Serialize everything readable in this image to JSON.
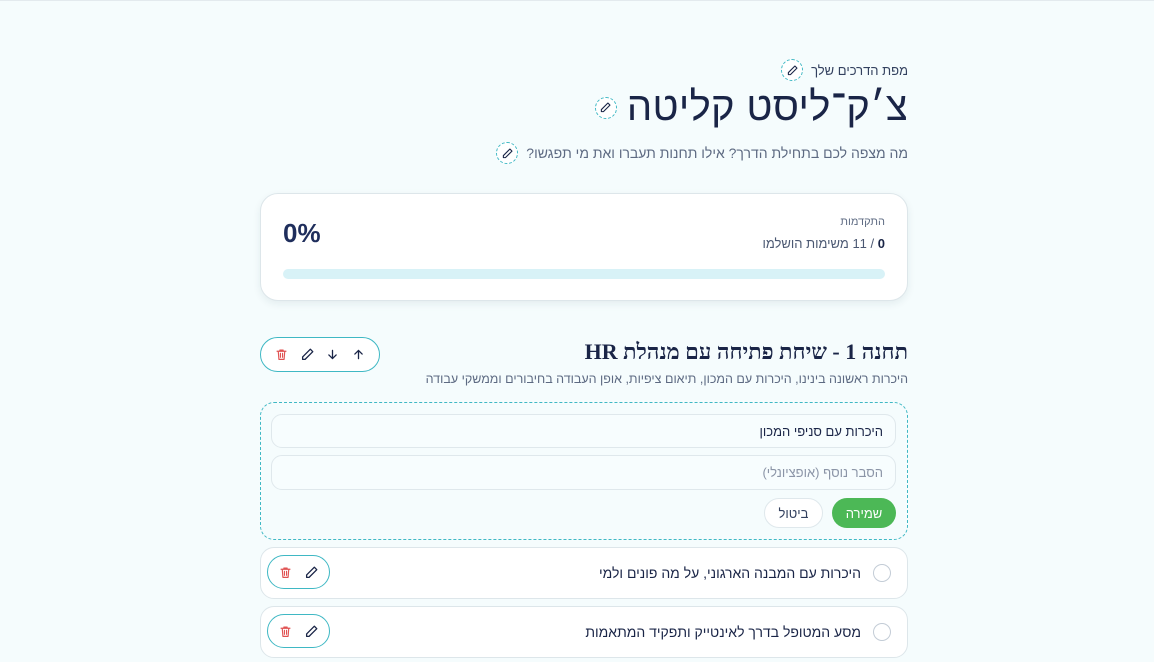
{
  "header": {
    "eyebrow": "מפת הדרכים שלך",
    "title": "צ׳ק־ליסט קליטה",
    "subtitle": "מה מצפה לכם בתחילת הדרך? אילו תחנות תעברו ואת מי תפגשו?"
  },
  "progress": {
    "label": "התקדמות",
    "completed": "0",
    "total_text": "/ 11 משימות הושלמו",
    "percent_text": "0%",
    "fraction": 0
  },
  "station": {
    "title": "תחנה 1 - שיחת פתיחה עם מנהלת HR",
    "description": "היכרות ראשונה בינינו, היכרות עם המכון, תיאום ציפיות, אופן העבודה בחיבורים וממשקי עבודה"
  },
  "edit_form": {
    "title_value": "היכרות עם סניפי המכון",
    "description_placeholder": "הסבר נוסף (אופציונלי)",
    "save_label": "שמירה",
    "cancel_label": "ביטול"
  },
  "tasks": [
    {
      "text": "היכרות עם המבנה הארגוני, על מה פונים ולמי"
    },
    {
      "text": "מסע המטופל בדרך לאינטייק ותפקיד המתאמות"
    }
  ],
  "colors": {
    "accent": "#3fb8c4",
    "save": "#4cb856",
    "delete": "#e05252",
    "title": "#1a2547"
  }
}
